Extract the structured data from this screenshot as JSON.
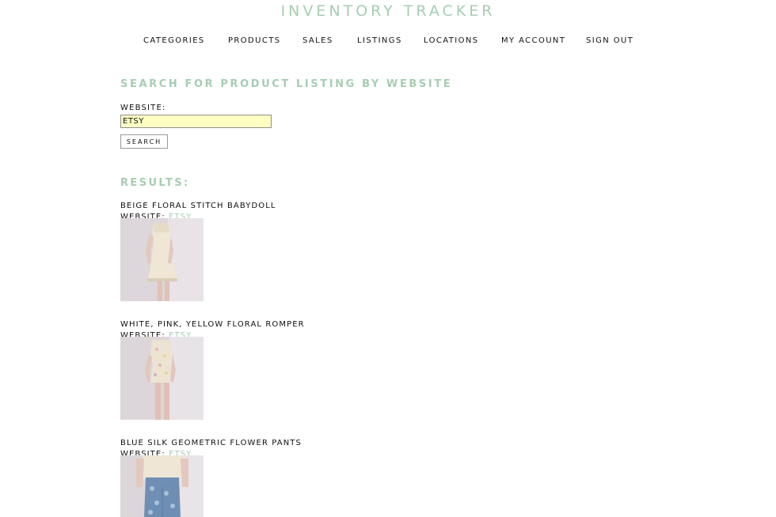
{
  "app": {
    "title": "INVENTORY TRACKER"
  },
  "nav": {
    "items": [
      {
        "label": "CATEGORIES"
      },
      {
        "label": "PRODUCTS"
      },
      {
        "label": "SALES"
      },
      {
        "label": "LISTINGS"
      },
      {
        "label": "LOCATIONS"
      },
      {
        "label": "MY ACCOUNT"
      },
      {
        "label": "SIGN OUT"
      }
    ]
  },
  "search": {
    "heading": "SEARCH FOR PRODUCT LISTING BY WEBSITE",
    "website_label": "WEBSITE:",
    "website_value": "ETSY",
    "button_label": "SEARCH"
  },
  "results": {
    "heading": "RESULTS:",
    "items": [
      {
        "title": "BEIGE FLORAL STITCH BABYDOLL",
        "website_prefix": "WEBSITE:",
        "website": "ETSY",
        "image_icon": "dress-photo"
      },
      {
        "title": "WHITE, PINK, YELLOW FLORAL ROMPER",
        "website_prefix": "WEBSITE:",
        "website": "ETSY",
        "image_icon": "romper-photo"
      },
      {
        "title": "BLUE SILK GEOMETRIC FLOWER PANTS",
        "website_prefix": "WEBSITE:",
        "website": "ETSY",
        "image_icon": "pants-photo"
      }
    ]
  },
  "colors": {
    "accent": "#a6cdb2",
    "input_bg": "#ffffc4",
    "text": "#111111"
  }
}
